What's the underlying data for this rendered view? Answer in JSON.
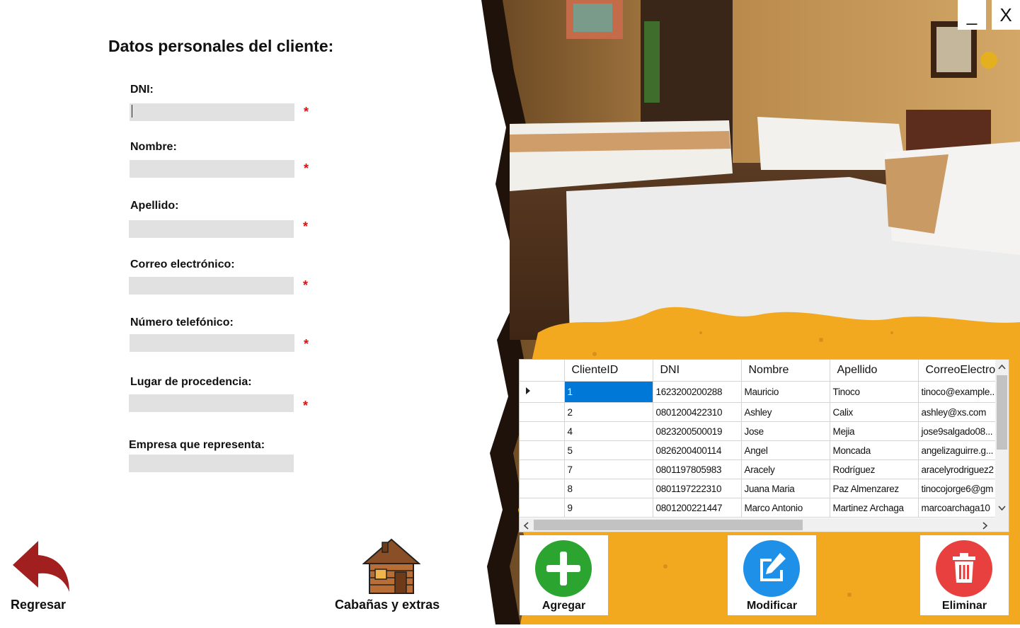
{
  "window": {
    "minimize_label": "_",
    "close_label": "X"
  },
  "form": {
    "title": "Datos personales del cliente:",
    "required_mark": "*",
    "fields": [
      {
        "label": "DNI:",
        "value": ""
      },
      {
        "label": "Nombre:",
        "value": ""
      },
      {
        "label": "Apellido:",
        "value": ""
      },
      {
        "label": "Correo electrónico:",
        "value": ""
      },
      {
        "label": "Número telefónico:",
        "value": ""
      },
      {
        "label": "Lugar de procedencia:",
        "value": ""
      },
      {
        "label": "Empresa que representa:",
        "value": ""
      }
    ]
  },
  "nav": {
    "back_label": "Regresar",
    "cabins_label": "Cabañas y extras"
  },
  "grid": {
    "columns": [
      "ClienteID",
      "DNI",
      "Nombre",
      "Apellido",
      "CorreoElectro"
    ],
    "rows": [
      [
        "1",
        "1623200200288",
        "Mauricio",
        "Tinoco",
        "tinoco@example..."
      ],
      [
        "2",
        "0801200422310",
        "Ashley",
        "Calix",
        "ashley@xs.com"
      ],
      [
        "4",
        "0823200500019",
        "Jose",
        "Mejia",
        "jose9salgado08..."
      ],
      [
        "5",
        "0826200400114",
        "Angel",
        "Moncada",
        "angelizaguirre.g..."
      ],
      [
        "7",
        "0801197805983",
        "Aracely",
        "Rodríguez",
        "aracelyrodriguez2"
      ],
      [
        "8",
        "0801197222310",
        "Juana Maria",
        "Paz Almenzarez",
        "tinocojorge6@gm"
      ],
      [
        "9",
        "0801200221447",
        "Marco Antonio",
        "Martinez Archaga",
        "marcoarchaga10"
      ]
    ]
  },
  "actions": {
    "add_label": "Agregar",
    "edit_label": "Modificar",
    "delete_label": "Eliminar"
  },
  "colors": {
    "accent_orange": "#f2a91f",
    "add_green": "#2ba52f",
    "edit_blue": "#1e90e8",
    "delete_red": "#e8403e",
    "back_arrow": "#a11f1f",
    "selection_blue": "#0078d7"
  }
}
